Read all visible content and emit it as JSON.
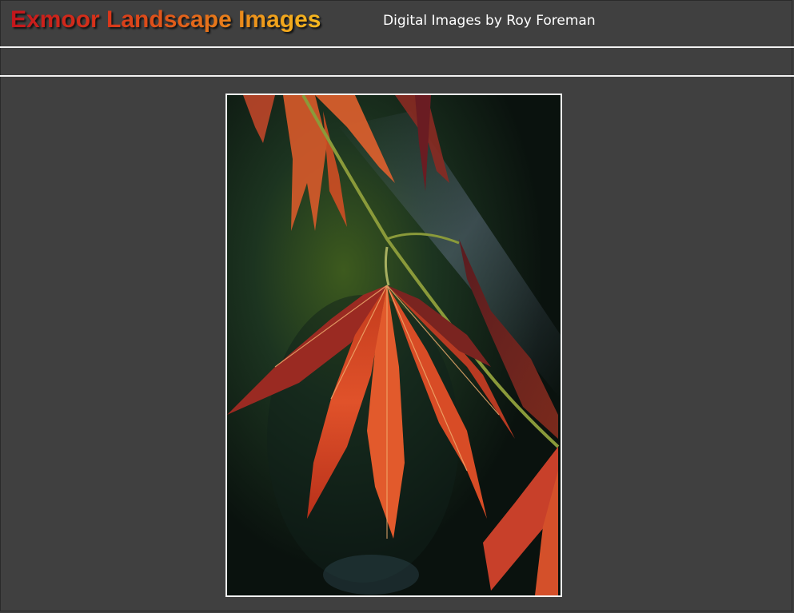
{
  "header": {
    "site_title": "Exmoor Landscape Images",
    "site_subtitle": "Digital Images by Roy Foreman"
  },
  "photo": {
    "subject": "red-maple-leaf-photo"
  },
  "colors": {
    "page_background": "#404040",
    "divider": "#f2f2f2",
    "title_gradient_start": "#c4161c",
    "title_gradient_end": "#f6b81f",
    "photo_border": "#f4f4f4"
  }
}
